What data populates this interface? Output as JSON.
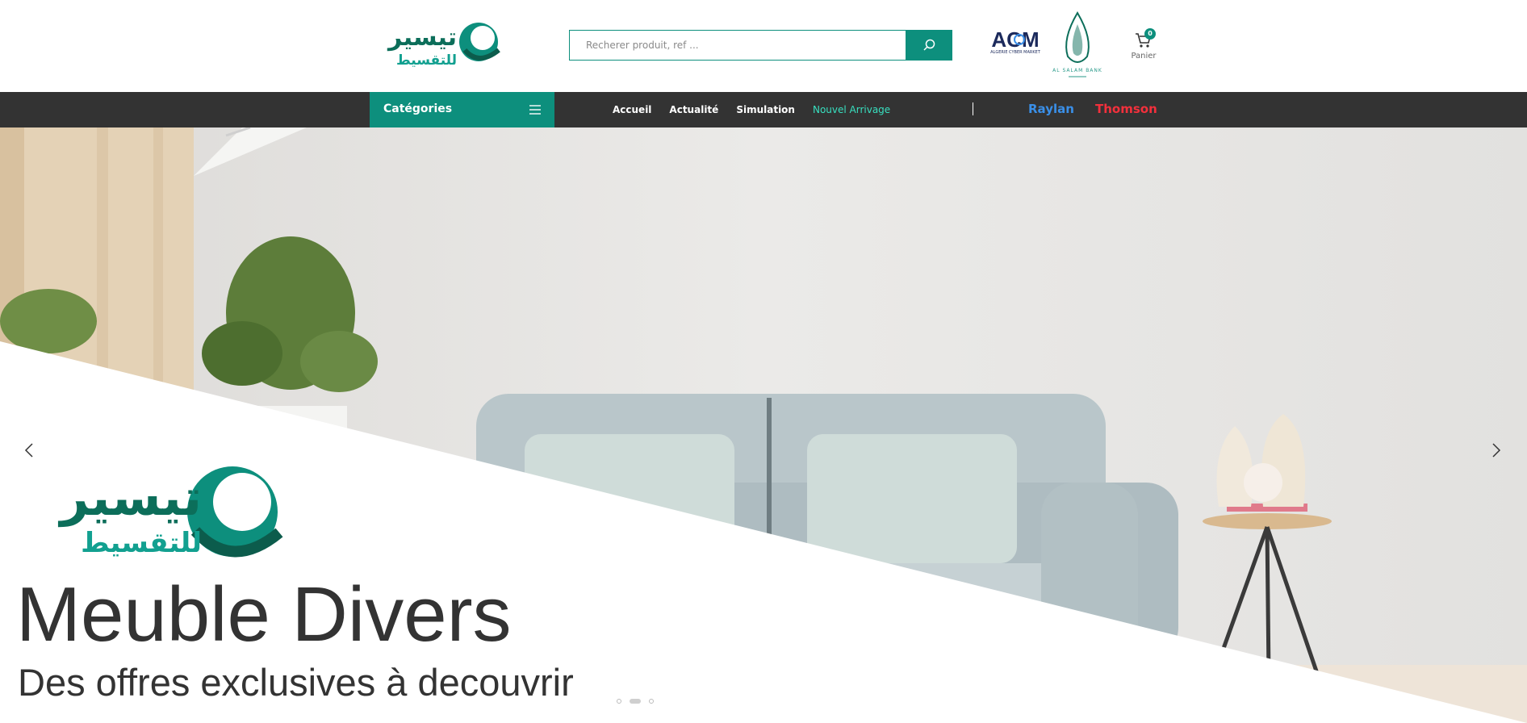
{
  "header": {
    "logo_arabic_top": "تيسير",
    "logo_arabic_bottom": "للتقسيط",
    "search": {
      "placeholder": "Recherer produit, ref ..."
    },
    "partners": {
      "acm_text": "ACM",
      "acm_subtext": "ALGERIE CYBER MARKET",
      "salam_text": "AL SALAM BANK"
    },
    "cart": {
      "count": "0",
      "label": "Panier"
    }
  },
  "nav": {
    "categories_label": "Catégories",
    "links": [
      "Accueil",
      "Actualité",
      "Simulation",
      "Nouvel Arrivage"
    ],
    "brands": [
      "Raylan",
      "Thomson"
    ]
  },
  "hero": {
    "title": "Meuble Divers",
    "subtitle": "Des offres exclusives à decouvrir",
    "logo_arabic_top": "تيسير",
    "logo_arabic_bottom": "للتقسيط",
    "slides_count": 3,
    "active_slide": 2
  },
  "colors": {
    "brand_teal": "#0d8f7d",
    "nav_bg": "#333333",
    "nav_new_link": "#38e0c0",
    "raylan": "#3a8fe8",
    "thomson": "#f3303c"
  }
}
